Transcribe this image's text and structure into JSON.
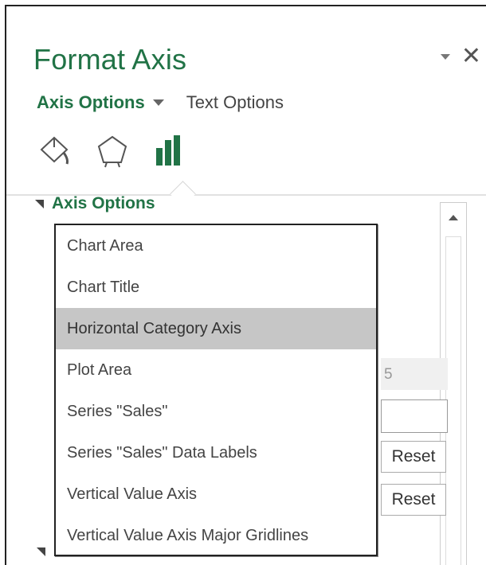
{
  "pane": {
    "title": "Format Axis",
    "tabs": [
      {
        "label": "Axis Options",
        "active": true
      },
      {
        "label": "Text Options",
        "active": false
      }
    ],
    "icons": [
      "fill-line-icon",
      "effects-pentagon-icon",
      "axis-options-bars-icon"
    ],
    "section": {
      "label": "Axis Options"
    }
  },
  "menu": {
    "items": [
      {
        "label": "Chart Area"
      },
      {
        "label": "Chart Title"
      },
      {
        "label": "Horizontal Category Axis",
        "selected": true
      },
      {
        "label": "Plot Area"
      },
      {
        "label": "Series \"Sales\""
      },
      {
        "label": "Series \"Sales\" Data Labels"
      },
      {
        "label": "Vertical Value Axis"
      },
      {
        "label": "Vertical Value Axis Major Gridlines"
      }
    ]
  },
  "background_controls": {
    "partial_value": "5",
    "reset_labels": [
      "Reset",
      "Reset"
    ]
  },
  "colors": {
    "accent_green": "#217346",
    "selected_item_bg": "#c6c6c6"
  }
}
